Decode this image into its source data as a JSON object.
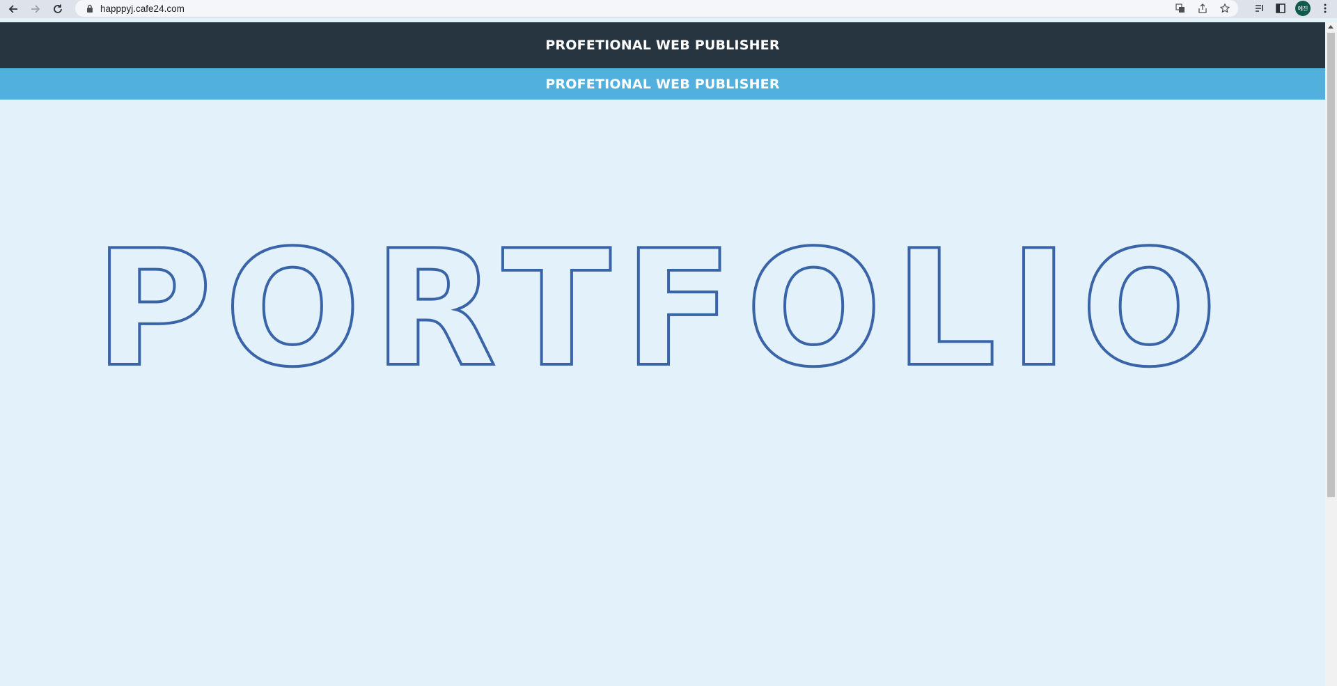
{
  "browser": {
    "url": "happpyj.cafe24.com",
    "profile_initials": "예진"
  },
  "header": {
    "dark_title": "PROFETIONAL WEB PUBLISHER",
    "light_title": "PROFETIONAL WEB PUBLISHER"
  },
  "hero": {
    "title": "PORTFOLIO"
  },
  "colors": {
    "header_dark": "#263540",
    "header_light": "#52b0de",
    "page_bg": "#e3f1fb",
    "outline": "#3a64a8"
  }
}
